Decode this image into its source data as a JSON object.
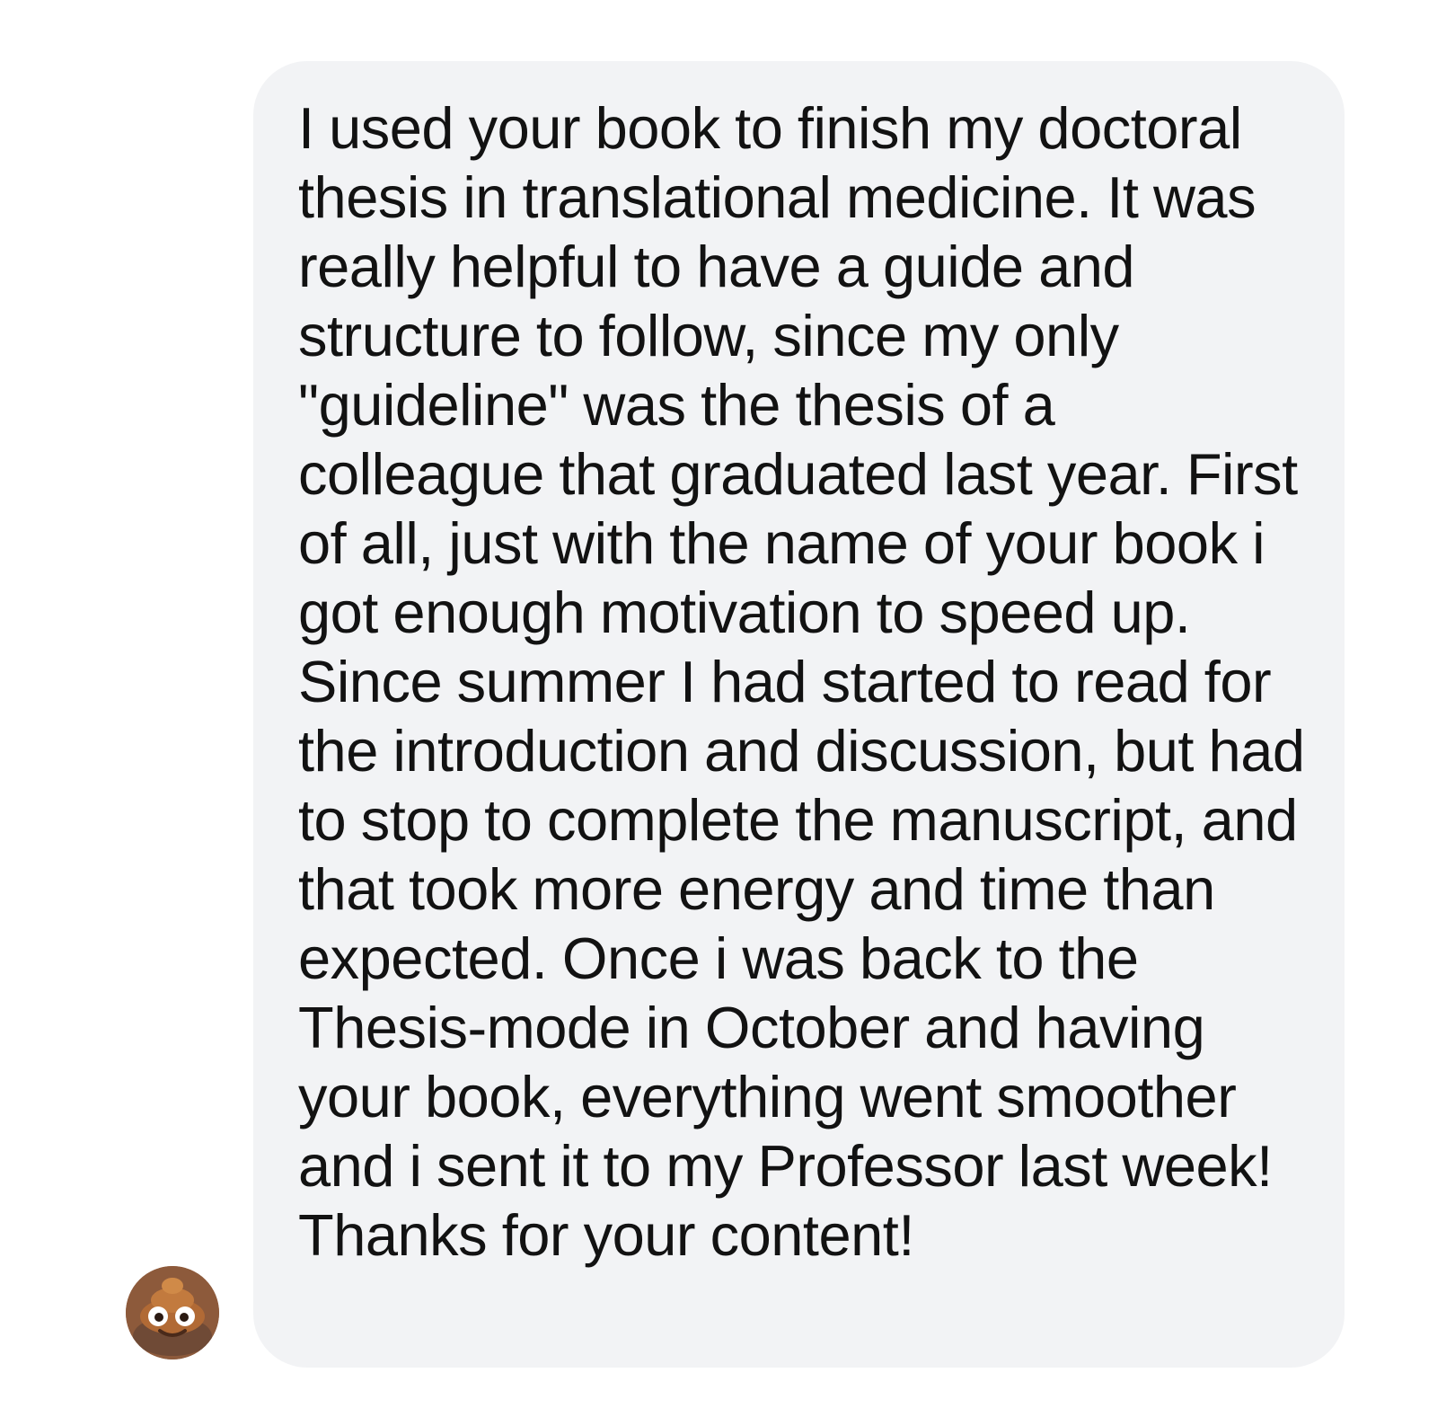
{
  "message": {
    "text": "I used your book to finish my doctoral thesis in translational medicine. It was really helpful to have a guide and structure to follow, since my only \"guideline\" was the thesis of a colleague that graduated last year. First of all, just with the name of your book i got enough motivation to speed up. Since summer I had started to read for the introduction and discussion, but had to stop to complete the manuscript, and that took more energy and time than expected. Once i was back to the Thesis-mode in October and having your book, everything went smoother and i sent it to my Professor last week! Thanks for your content!"
  },
  "avatar": {
    "icon": "emoji-avatar-icon",
    "colors": {
      "primary": "#a7673b",
      "dark": "#5e3a2a"
    }
  },
  "theme": {
    "bubble_background": "#f2f3f5",
    "text_color": "#121212",
    "page_background": "#ffffff"
  }
}
